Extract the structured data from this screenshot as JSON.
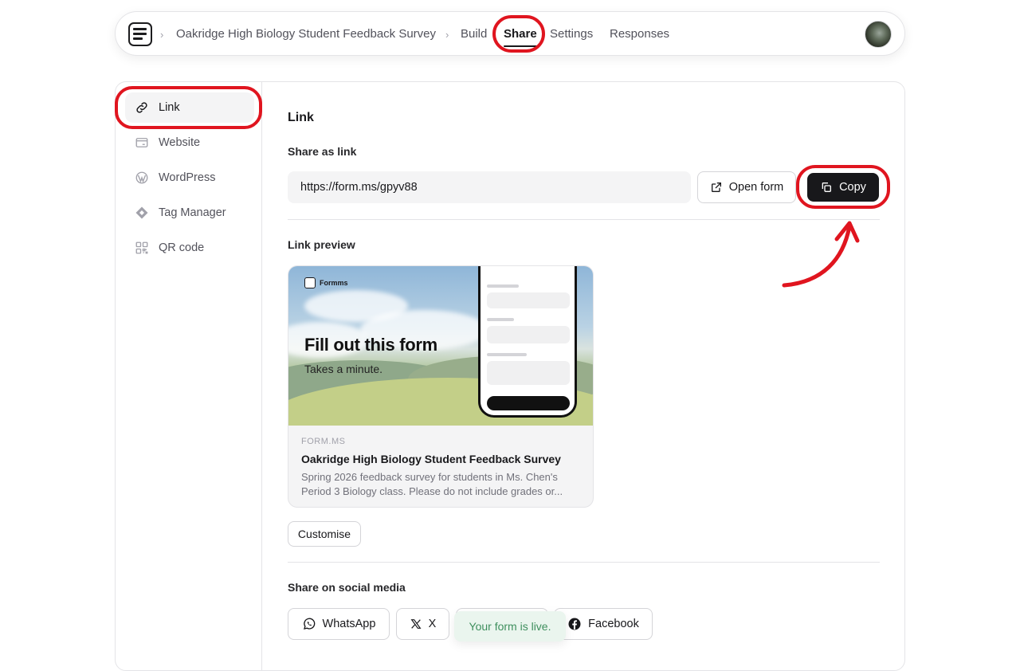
{
  "topbar": {
    "breadcrumb_title": "Oakridge High Biology Student Feedback Survey",
    "tabs": [
      {
        "label": "Build"
      },
      {
        "label": "Share"
      },
      {
        "label": "Settings"
      },
      {
        "label": "Responses"
      }
    ],
    "active_tab": "Share"
  },
  "sidebar": {
    "items": [
      {
        "label": "Link",
        "icon": "link-icon",
        "active": true
      },
      {
        "label": "Website",
        "icon": "window-icon"
      },
      {
        "label": "WordPress",
        "icon": "wordpress-icon"
      },
      {
        "label": "Tag Manager",
        "icon": "diamond-icon"
      },
      {
        "label": "QR code",
        "icon": "qr-icon"
      }
    ]
  },
  "main": {
    "heading": "Link",
    "share_as_link_label": "Share as link",
    "url": "https://form.ms/gpyv88",
    "open_form_label": "Open form",
    "copy_label": "Copy",
    "link_preview_label": "Link preview",
    "preview": {
      "brand": "Formms",
      "headline": "Fill out this form",
      "subline": "Takes a minute.",
      "domain": "FORM.MS",
      "title": "Oakridge High Biology Student Feedback Survey",
      "description_line1": "Spring 2026 feedback survey for students in Ms. Chen's",
      "description_line2": "Period 3 Biology class. Please do not include grades or..."
    },
    "customise_label": "Customise",
    "social_label": "Share on social media",
    "social_buttons": [
      {
        "label": "WhatsApp",
        "icon": "whatsapp-icon"
      },
      {
        "label": "X",
        "icon": "x-logo-icon"
      },
      {
        "label": "",
        "icon": ""
      },
      {
        "label": "Facebook",
        "icon": "facebook-icon"
      }
    ]
  },
  "toast": "Your form is live.",
  "colors": {
    "highlight": "#e0151f",
    "primary_button": "#18181b",
    "toast_bg": "#eaf5ee",
    "toast_text": "#3f8f5e"
  }
}
